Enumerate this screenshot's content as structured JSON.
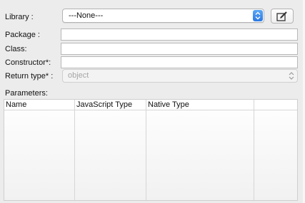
{
  "library": {
    "label": "Library :",
    "value": "---None---"
  },
  "package": {
    "label": "Package :",
    "value": ""
  },
  "class": {
    "label": "Class:",
    "value": ""
  },
  "constructor": {
    "label": "Constructor*:",
    "value": ""
  },
  "return_type": {
    "label": "Return type* :",
    "value": "object"
  },
  "parameters": {
    "label": "Parameters:",
    "columns": [
      "Name",
      "JavaScript Type",
      "Native Type",
      ""
    ],
    "rows": []
  },
  "icons": {
    "stepper": "up-down-chevron-icon",
    "edit": "edit-pencil-icon"
  },
  "colors": {
    "accent": "#2a78e4",
    "panel_bg": "#ececec",
    "disabled_text": "#a5a5a5"
  }
}
